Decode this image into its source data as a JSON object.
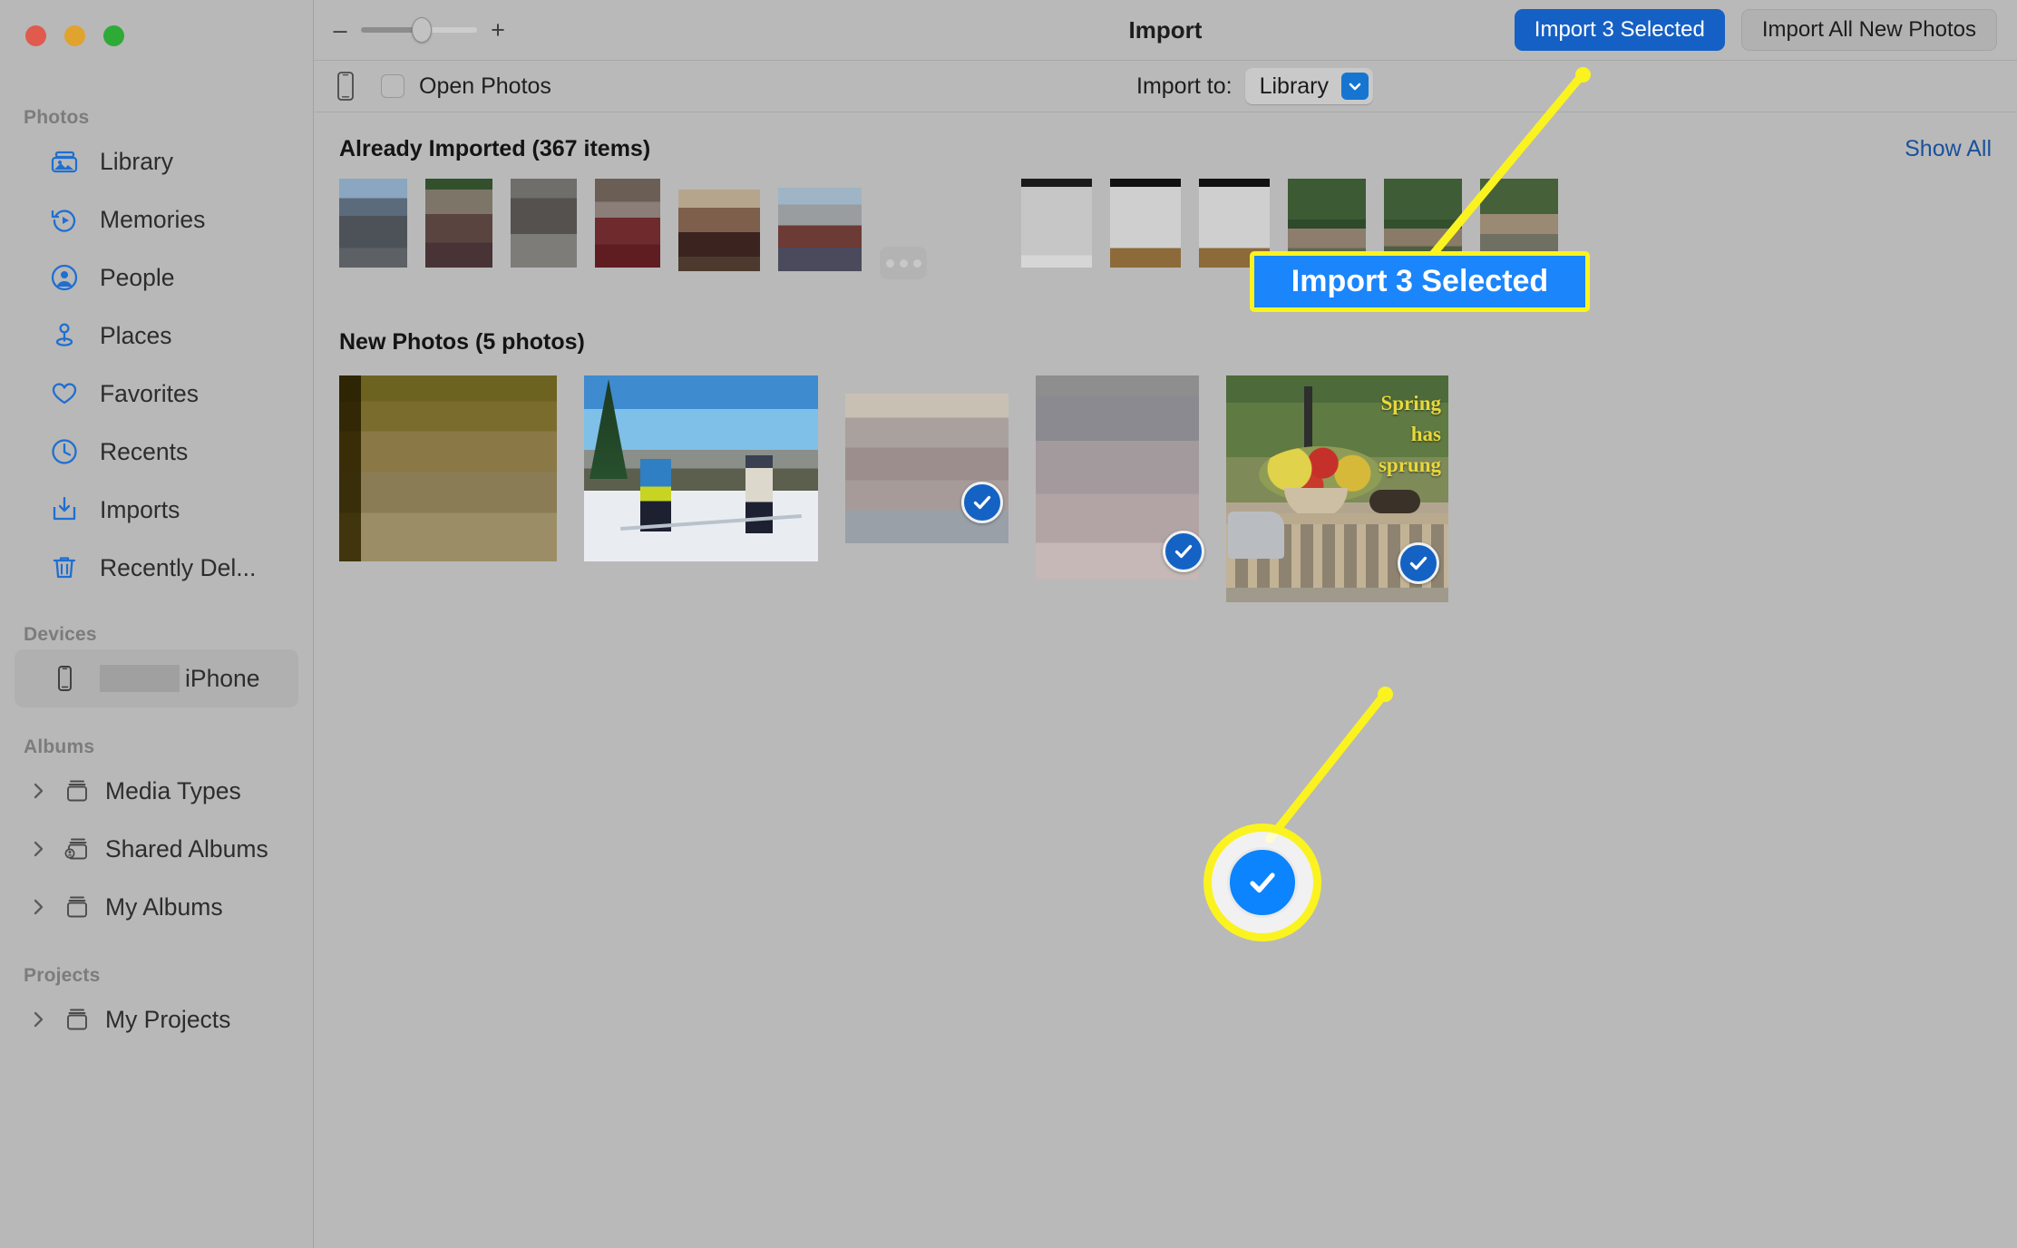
{
  "window": {
    "title": "Import",
    "traffic_lights": [
      "close",
      "minimize",
      "zoom"
    ]
  },
  "toolbar": {
    "zoom_minus": "–",
    "zoom_plus": "+",
    "zoom_value": 55,
    "import_selected_label": "Import 3 Selected",
    "import_all_label": "Import All New Photos"
  },
  "subbar": {
    "device_icon": "iphone-icon",
    "open_photos_label": "Open Photos",
    "open_photos_checked": false,
    "import_to_label": "Import to:",
    "import_to_value": "Library",
    "import_to_options": [
      "Library"
    ]
  },
  "sidebar": {
    "groups": [
      {
        "label": "Photos",
        "items": [
          {
            "label": "Library",
            "icon": "photo-stack-icon",
            "selected": false
          },
          {
            "label": "Memories",
            "icon": "memories-icon",
            "selected": false
          },
          {
            "label": "People",
            "icon": "person-circle-icon",
            "selected": false
          },
          {
            "label": "Places",
            "icon": "map-pin-icon",
            "selected": false
          },
          {
            "label": "Favorites",
            "icon": "heart-icon",
            "selected": false
          },
          {
            "label": "Recents",
            "icon": "clock-icon",
            "selected": false
          },
          {
            "label": "Imports",
            "icon": "import-tray-icon",
            "selected": false
          },
          {
            "label": "Recently Del...",
            "icon": "trash-icon",
            "selected": false
          }
        ]
      },
      {
        "label": "Devices",
        "items": [
          {
            "label": "iPhone",
            "icon": "iphone-icon",
            "selected": true,
            "redacted_prefix": true
          }
        ]
      },
      {
        "label": "Albums",
        "items": [
          {
            "label": "Media Types",
            "icon": "album-icon",
            "disclosure": true
          },
          {
            "label": "Shared Albums",
            "icon": "shared-album-icon",
            "disclosure": true
          },
          {
            "label": "My Albums",
            "icon": "album-icon",
            "disclosure": true
          }
        ]
      },
      {
        "label": "Projects",
        "items": [
          {
            "label": "My Projects",
            "icon": "album-icon",
            "disclosure": true
          }
        ]
      }
    ]
  },
  "already_imported": {
    "title": "Already Imported (367 items)",
    "show_all_label": "Show All",
    "count": 367,
    "overflow_label": "more-thumbnails-ellipsis"
  },
  "new_photos": {
    "title": "New Photos (5 photos)",
    "count": 5,
    "items": [
      {
        "name": "photo-1-blurred-portrait",
        "selected": false
      },
      {
        "name": "photo-2-skiers-on-snowy-hill",
        "selected": false
      },
      {
        "name": "photo-3-blurred-interior-people",
        "selected": true
      },
      {
        "name": "photo-4-blurred-person-closeup",
        "selected": true
      },
      {
        "name": "photo-5-spring-has-sprung-flower-basket",
        "selected": true,
        "caption": "Spring has sprung"
      }
    ]
  },
  "annotations": {
    "badge_import_label": "Import 3 Selected",
    "ring_target": "selection-checkmark",
    "highlight_color": "#fbf31f",
    "badge_fill": "#1b85fb"
  }
}
